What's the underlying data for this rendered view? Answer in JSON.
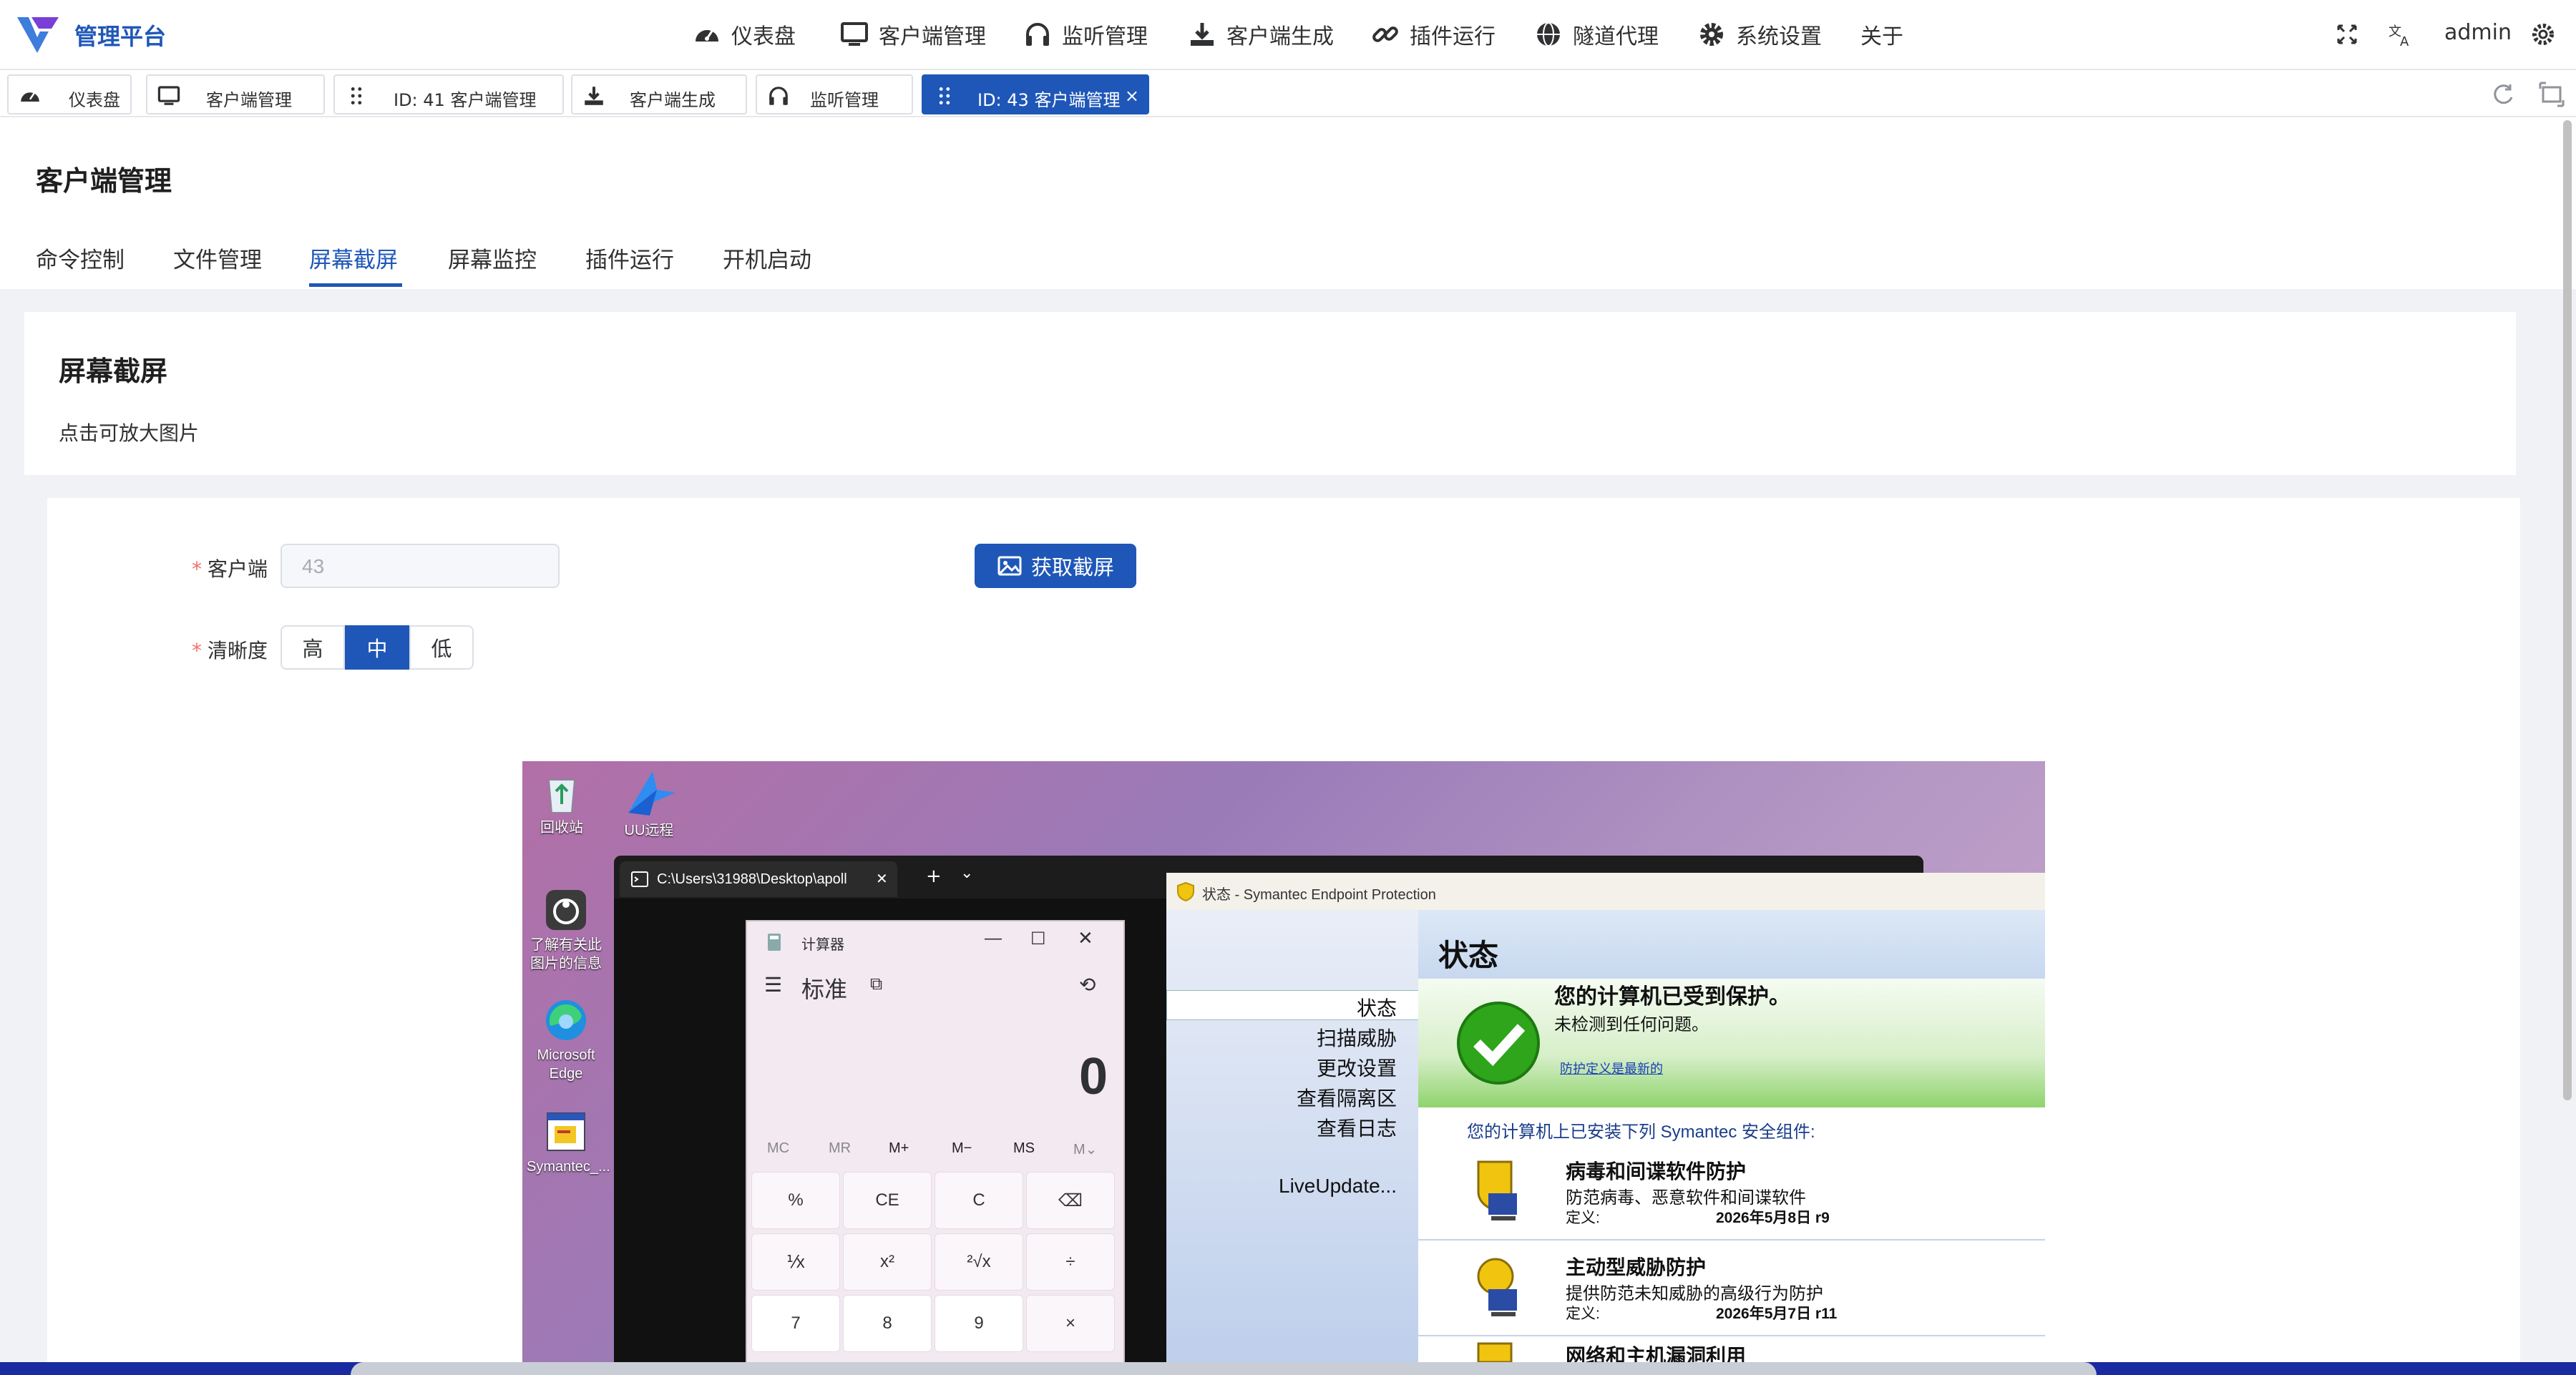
{
  "brand": "管理平台",
  "nav": [
    {
      "label": "仪表盘",
      "icon": "dashboard-icon"
    },
    {
      "label": "客户端管理",
      "icon": "monitor-icon"
    },
    {
      "label": "监听管理",
      "icon": "headphones-icon"
    },
    {
      "label": "客户端生成",
      "icon": "download-icon"
    },
    {
      "label": "插件运行",
      "icon": "link-icon"
    },
    {
      "label": "隧道代理",
      "icon": "globe-icon"
    },
    {
      "label": "系统设置",
      "icon": "gear-icon"
    },
    {
      "label": "关于",
      "icon": ""
    }
  ],
  "user": "admin",
  "tabs": [
    {
      "label": "仪表盘",
      "icon": "dashboard-icon"
    },
    {
      "label": "客户端管理",
      "icon": "monitor-icon"
    },
    {
      "label": "ID: 41 客户端管理",
      "icon": "drag-icon"
    },
    {
      "label": "客户端生成",
      "icon": "download-icon"
    },
    {
      "label": "监听管理",
      "icon": "headphones-icon"
    },
    {
      "label": "ID: 43 客户端管理",
      "icon": "drag-icon",
      "active": true,
      "close": "×"
    }
  ],
  "page_title": "客户端管理",
  "subtabs": [
    "命令控制",
    "文件管理",
    "屏幕截屏",
    "屏幕监控",
    "插件运行",
    "开机启动"
  ],
  "active_subtab": "屏幕截屏",
  "card": {
    "title": "屏幕截屏",
    "desc": "点击可放大图片"
  },
  "form": {
    "required_mark": "*",
    "client_label": "客户端",
    "client_value": "43",
    "quality_label": "清晰度",
    "quality_options": [
      "高",
      "中",
      "低"
    ],
    "quality_selected": "中",
    "capture_button": "获取截屏"
  },
  "screenshot": {
    "desktop_icons": [
      "回收站",
      "UU远程",
      "了解有关此图片的信息",
      "Microsoft Edge",
      "Symantec_..."
    ],
    "terminal_tab": "C:\\Users\\31988\\Desktop\\apoll",
    "terminal_new_tab": "+",
    "terminal_close": "✕",
    "terminal_dropdown": "⌄",
    "calculator": {
      "title": "计算器",
      "mode": "标准",
      "display": "0",
      "memory": [
        "MC",
        "MR",
        "M+",
        "M−",
        "MS",
        "M⌄"
      ],
      "keys": [
        "%",
        "CE",
        "C",
        "⌫",
        "⅟x",
        "x²",
        "²√x",
        "÷",
        "7",
        "8",
        "9",
        "×"
      ]
    },
    "sep": {
      "window_title": "状态 - Symantec Endpoint Protection",
      "heading": "状态",
      "nav": [
        "状态",
        "扫描威胁",
        "更改设置",
        "查看隔离区",
        "查看日志",
        "LiveUpdate..."
      ],
      "protected_title": "您的计算机已受到保护。",
      "protected_sub": "未检测到任何问题。",
      "defs_link": "防护定义是最新的",
      "installed_text": "您的计算机上已安装下列 Symantec 安全组件:",
      "components": [
        {
          "name": "病毒和间谍软件防护",
          "desc": "防范病毒、恶意软件和间谍软件",
          "def_label": "定义:",
          "def_value": "2026年5月8日 r9"
        },
        {
          "name": "主动型威胁防护",
          "desc": "提供防范未知威胁的高级行为防护",
          "def_label": "定义:",
          "def_value": "2026年5月7日 r11"
        },
        {
          "name": "网络和主机漏洞利用",
          "desc": "",
          "def_label": "",
          "def_value": ""
        }
      ]
    }
  },
  "colors": {
    "primary": "#1f57b8",
    "required": "#f56c6c"
  }
}
